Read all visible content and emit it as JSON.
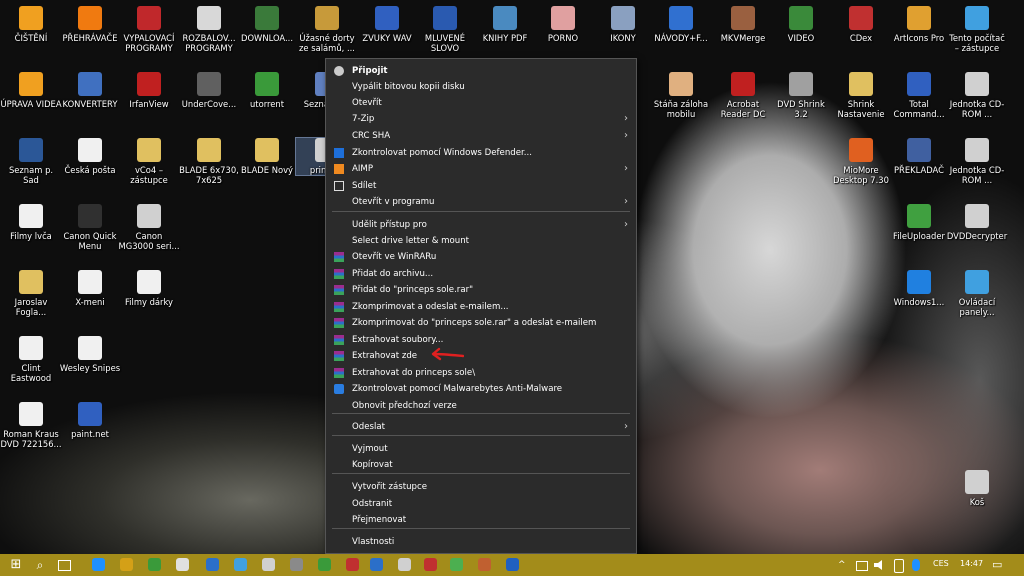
{
  "desktop_icons": [
    {
      "label": "ČIŠTĚNÍ",
      "color": "#f0a020"
    },
    {
      "label": "PŘEHRÁVAČE",
      "color": "#f07a10"
    },
    {
      "label": "VYPALOVACÍ PROGRAMY",
      "color": "#c0282b"
    },
    {
      "label": "ROZBALOV... PROGRAMY",
      "color": "#d8d8d8"
    },
    {
      "label": "DOWNLOA...",
      "color": "#3a7a3a"
    },
    {
      "label": "Úžasné dorty ze salámů, ...",
      "color": "#c79a3a"
    },
    {
      "label": "ZVUKY WAV",
      "color": "#3060c0"
    },
    {
      "label": "MLUVENÉ SLOVO",
      "color": "#2a5ab0"
    },
    {
      "label": "KNIHY PDF",
      "color": "#4a8ac0"
    },
    {
      "label": "PORNO",
      "color": "#e0a0a0"
    },
    {
      "label": "IKONY",
      "color": "#8aa0c0"
    },
    {
      "label": "NÁVODY+F...",
      "color": "#3070d0"
    },
    {
      "label": "MKVMerge",
      "color": "#9a6040"
    },
    {
      "label": "VIDEO",
      "color": "#3a8a3a"
    },
    {
      "label": "CDex",
      "color": "#c03030"
    },
    {
      "label": "ArtIcons Pro",
      "color": "#e0a030"
    },
    {
      "label": "Tento počítač – zástupce",
      "color": "#40a0e0"
    },
    {
      "label": "ÚPRAVA VIDEA",
      "color": "#f0a020"
    },
    {
      "label": "KONVERTERY",
      "color": "#4070c0"
    },
    {
      "label": "IrfanView",
      "color": "#c02020"
    },
    {
      "label": "UnderCove...",
      "color": "#606060"
    },
    {
      "label": "utorrent",
      "color": "#3a9a3a"
    },
    {
      "label": "Sezna... 20",
      "color": "#6080c0"
    },
    {
      "label": "Stáňa záloha mobilu",
      "color": "#e0b080"
    },
    {
      "label": "Acrobat Reader DC",
      "color": "#c02020"
    },
    {
      "label": "DVD Shrink 3.2",
      "color": "#a0a0a0"
    },
    {
      "label": "Shrink Nastavenie",
      "color": "#e0c060"
    },
    {
      "label": "Total Command...",
      "color": "#3060c0"
    },
    {
      "label": "Jednotka CD-ROM ...",
      "color": "#d0d0d0"
    },
    {
      "label": "Seznam p. Sad",
      "color": "#2b5797"
    },
    {
      "label": "Česká pošta",
      "color": "#f0f0f0"
    },
    {
      "label": "vCo4 – zástupce",
      "color": "#e0c060"
    },
    {
      "label": "BLADE 6x730, 7x625",
      "color": "#e0c060"
    },
    {
      "label": "BLADE Nový",
      "color": "#e0c060"
    },
    {
      "label": "prince...",
      "color": "#d0d0d0"
    },
    {
      "label": "MioMore Desktop 7.30",
      "color": "#e06020"
    },
    {
      "label": "PŘEKLADAČ",
      "color": "#4060a0"
    },
    {
      "label": "Jednotka CD-ROM ...",
      "color": "#d0d0d0"
    },
    {
      "label": "Filmy lvča",
      "color": "#f0f0f0"
    },
    {
      "label": "Canon Quick Menu",
      "color": "#303030"
    },
    {
      "label": "Canon MG3000 seri...",
      "color": "#d0d0d0"
    },
    {
      "label": "FileUploader",
      "color": "#40a040"
    },
    {
      "label": "DVDDecrypter",
      "color": "#d0d0d0"
    },
    {
      "label": "Jaroslav Fogla...",
      "color": "#e0c060"
    },
    {
      "label": "X-meni",
      "color": "#f0f0f0"
    },
    {
      "label": "Filmy dárky",
      "color": "#f0f0f0"
    },
    {
      "label": "Windows1...",
      "color": "#2080e0"
    },
    {
      "label": "Ovládací panely...",
      "color": "#40a0e0"
    },
    {
      "label": "Clint Eastwood",
      "color": "#f0f0f0"
    },
    {
      "label": "Wesley Snipes",
      "color": "#f0f0f0"
    },
    {
      "label": "Roman Kraus DVD 722156...",
      "color": "#f0f0f0"
    },
    {
      "label": "paint.net",
      "color": "#3060c0"
    },
    {
      "label": "Koš",
      "color": "#d0d0d0"
    }
  ],
  "context_menu": {
    "items": [
      {
        "label": "Připojit",
        "bold": true,
        "icon": "disc-icon"
      },
      {
        "label": "Vypálit bitovou kopii disku"
      },
      {
        "label": "Otevřít"
      },
      {
        "label": "7-Zip",
        "submenu": true
      },
      {
        "label": "CRC SHA",
        "submenu": true
      },
      {
        "label": "Zkontrolovat pomocí Windows Defender...",
        "icon": "defender-icon"
      },
      {
        "label": "AIMP",
        "submenu": true,
        "icon": "aimp-icon"
      },
      {
        "label": "Sdílet",
        "icon": "share-icon"
      },
      {
        "label": "Otevřít v programu",
        "submenu": true
      },
      {
        "label": "Udělit přístup pro",
        "submenu": true
      },
      {
        "label": "Select drive letter & mount"
      },
      {
        "label": "Otevřít ve WinRARu",
        "icon": "winrar-icon"
      },
      {
        "label": "Přidat do archivu...",
        "icon": "winrar-icon"
      },
      {
        "label": "Přidat do \"princeps sole.rar\"",
        "icon": "winrar-icon"
      },
      {
        "label": "Zkomprimovat a odeslat e-mailem...",
        "icon": "winrar-icon"
      },
      {
        "label": "Zkomprimovat do \"princeps sole.rar\" a odeslat e-mailem",
        "icon": "winrar-icon"
      },
      {
        "label": "Extrahovat soubory...",
        "icon": "winrar-icon"
      },
      {
        "label": "Extrahovat zde",
        "icon": "winrar-icon"
      },
      {
        "label": "Extrahovat do princeps sole\\",
        "icon": "winrar-icon"
      },
      {
        "label": "Zkontrolovat pomocí Malwarebytes Anti-Malware",
        "icon": "malwarebytes-icon"
      },
      {
        "label": "Obnovit předchozí verze"
      },
      {
        "label": "Odeslat",
        "submenu": true
      },
      {
        "label": "Vyjmout"
      },
      {
        "label": "Kopírovat"
      },
      {
        "label": "Vytvořit zástupce"
      },
      {
        "label": "Odstranit"
      },
      {
        "label": "Přejmenovat"
      },
      {
        "label": "Vlastnosti"
      }
    ],
    "arrow_glyph": "›"
  },
  "taskbar": {
    "language": "CES",
    "clock": "14:47",
    "start_glyph": "⊞",
    "search_glyph": "⌕",
    "chevron_glyph": "^",
    "notification_glyph": "▭"
  }
}
